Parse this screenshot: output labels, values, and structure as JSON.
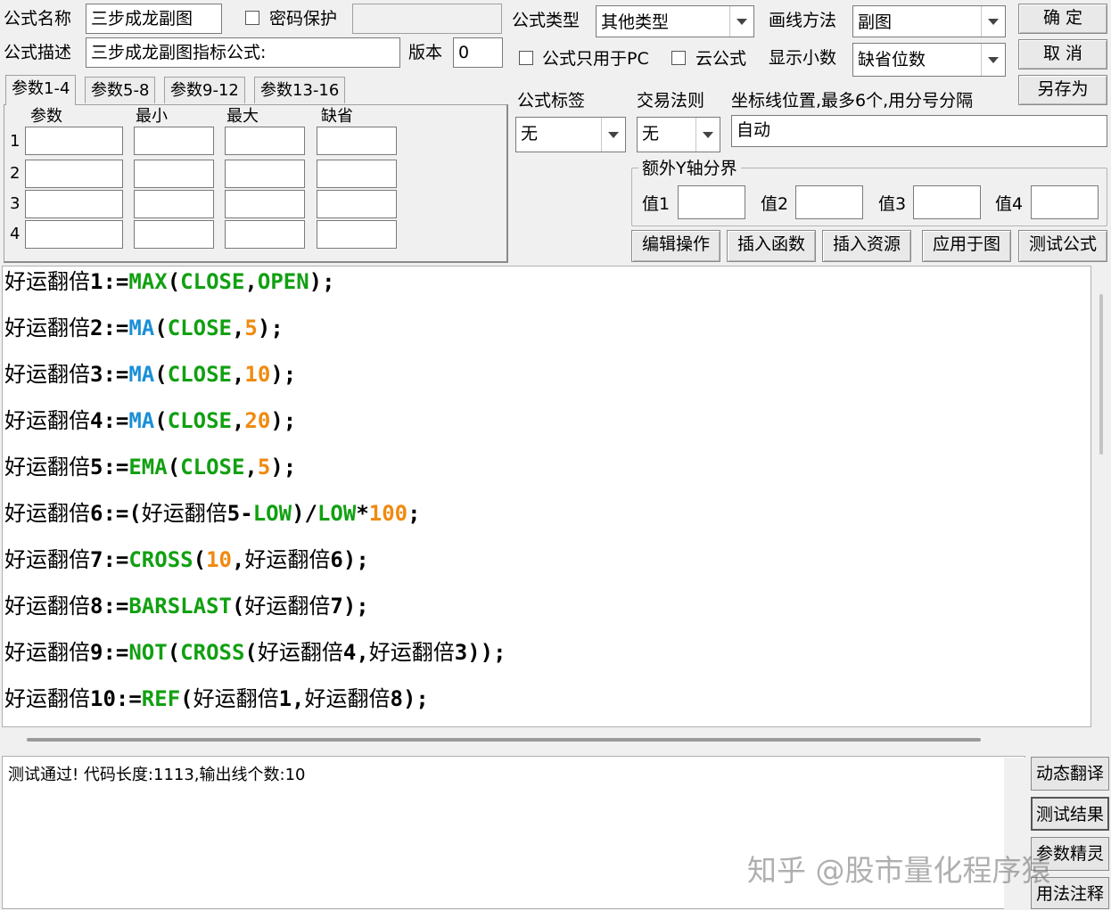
{
  "header": {
    "name_label": "公式名称",
    "name_value": "三步成龙副图",
    "password_label": "密码保护",
    "desc_label": "公式描述",
    "desc_value": "三步成龙副图指标公式:",
    "version_label": "版本",
    "version_value": "0",
    "type_label": "公式类型",
    "type_value": "其他类型",
    "draw_label": "画线方法",
    "draw_value": "副图",
    "pc_only_label": "公式只用于PC",
    "cloud_label": "云公式",
    "decimal_label": "显示小数",
    "decimal_value": "缺省位数"
  },
  "buttons": {
    "ok": "确 定",
    "cancel": "取 消",
    "save_as": "另存为",
    "edit": "编辑操作",
    "insert_func": "插入函数",
    "insert_res": "插入资源",
    "apply": "应用于图",
    "test": "测试公式"
  },
  "tabs": [
    "参数1-4",
    "参数5-8",
    "参数9-12",
    "参数13-16"
  ],
  "params": {
    "headers": [
      "参数",
      "最小",
      "最大",
      "缺省"
    ],
    "rows": [
      "1",
      "2",
      "3",
      "4"
    ]
  },
  "tag": {
    "label": "公式标签",
    "value": "无"
  },
  "rule": {
    "label": "交易法则",
    "value": "无"
  },
  "axis": {
    "label": "坐标线位置,最多6个,用分号分隔",
    "value": "自动"
  },
  "extra_y": {
    "label": "额外Y轴分界",
    "v1": "值1",
    "v2": "值2",
    "v3": "值3",
    "v4": "值4"
  },
  "code": [
    [
      [
        "id",
        "好运翻倍"
      ],
      [
        "op",
        "1:="
      ],
      [
        "g",
        "MAX"
      ],
      [
        "op",
        "("
      ],
      [
        "g",
        "CLOSE"
      ],
      [
        "op",
        ","
      ],
      [
        "g",
        "OPEN"
      ],
      [
        "op",
        ");"
      ]
    ],
    [
      [
        "id",
        "好运翻倍"
      ],
      [
        "op",
        "2:="
      ],
      [
        "b",
        "MA"
      ],
      [
        "op",
        "("
      ],
      [
        "g",
        "CLOSE"
      ],
      [
        "op",
        ","
      ],
      [
        "n",
        "5"
      ],
      [
        "op",
        ");"
      ]
    ],
    [
      [
        "id",
        "好运翻倍"
      ],
      [
        "op",
        "3:="
      ],
      [
        "b",
        "MA"
      ],
      [
        "op",
        "("
      ],
      [
        "g",
        "CLOSE"
      ],
      [
        "op",
        ","
      ],
      [
        "n",
        "10"
      ],
      [
        "op",
        ");"
      ]
    ],
    [
      [
        "id",
        "好运翻倍"
      ],
      [
        "op",
        "4:="
      ],
      [
        "b",
        "MA"
      ],
      [
        "op",
        "("
      ],
      [
        "g",
        "CLOSE"
      ],
      [
        "op",
        ","
      ],
      [
        "n",
        "20"
      ],
      [
        "op",
        ");"
      ]
    ],
    [
      [
        "id",
        "好运翻倍"
      ],
      [
        "op",
        "5:="
      ],
      [
        "g",
        "EMA"
      ],
      [
        "op",
        "("
      ],
      [
        "g",
        "CLOSE"
      ],
      [
        "op",
        ","
      ],
      [
        "n",
        "5"
      ],
      [
        "op",
        ");"
      ]
    ],
    [
      [
        "id",
        "好运翻倍"
      ],
      [
        "op",
        "6:=("
      ],
      [
        "id",
        "好运翻倍"
      ],
      [
        "op",
        "5-"
      ],
      [
        "g",
        "LOW"
      ],
      [
        "op",
        ")/"
      ],
      [
        "g",
        "LOW"
      ],
      [
        "op",
        "*"
      ],
      [
        "n",
        "100"
      ],
      [
        "op",
        ";"
      ]
    ],
    [
      [
        "id",
        "好运翻倍"
      ],
      [
        "op",
        "7:="
      ],
      [
        "g",
        "CROSS"
      ],
      [
        "op",
        "("
      ],
      [
        "n",
        "10"
      ],
      [
        "op",
        ","
      ],
      [
        "id",
        "好运翻倍"
      ],
      [
        "op",
        "6);"
      ]
    ],
    [
      [
        "id",
        "好运翻倍"
      ],
      [
        "op",
        "8:="
      ],
      [
        "g",
        "BARSLAST"
      ],
      [
        "op",
        "("
      ],
      [
        "id",
        "好运翻倍"
      ],
      [
        "op",
        "7);"
      ]
    ],
    [
      [
        "id",
        "好运翻倍"
      ],
      [
        "op",
        "9:="
      ],
      [
        "g",
        "NOT"
      ],
      [
        "op",
        "("
      ],
      [
        "g",
        "CROSS"
      ],
      [
        "op",
        "("
      ],
      [
        "id",
        "好运翻倍"
      ],
      [
        "op",
        "4,"
      ],
      [
        "id",
        "好运翻倍"
      ],
      [
        "op",
        "3));"
      ]
    ],
    [
      [
        "id",
        "好运翻倍"
      ],
      [
        "op",
        "10:="
      ],
      [
        "g",
        "REF"
      ],
      [
        "op",
        "("
      ],
      [
        "id",
        "好运翻倍"
      ],
      [
        "op",
        "1,"
      ],
      [
        "id",
        "好运翻倍"
      ],
      [
        "op",
        "8);"
      ]
    ]
  ],
  "output_text": "测试通过! 代码长度:1113,输出线个数:10",
  "side_buttons": [
    "动态翻译",
    "测试结果",
    "参数精灵",
    "用法注释"
  ],
  "watermark": "知乎 @股市量化程序猿",
  "colors": {
    "green": "#11a011",
    "blue": "#1a8fd6",
    "orange": "#f08a10"
  }
}
